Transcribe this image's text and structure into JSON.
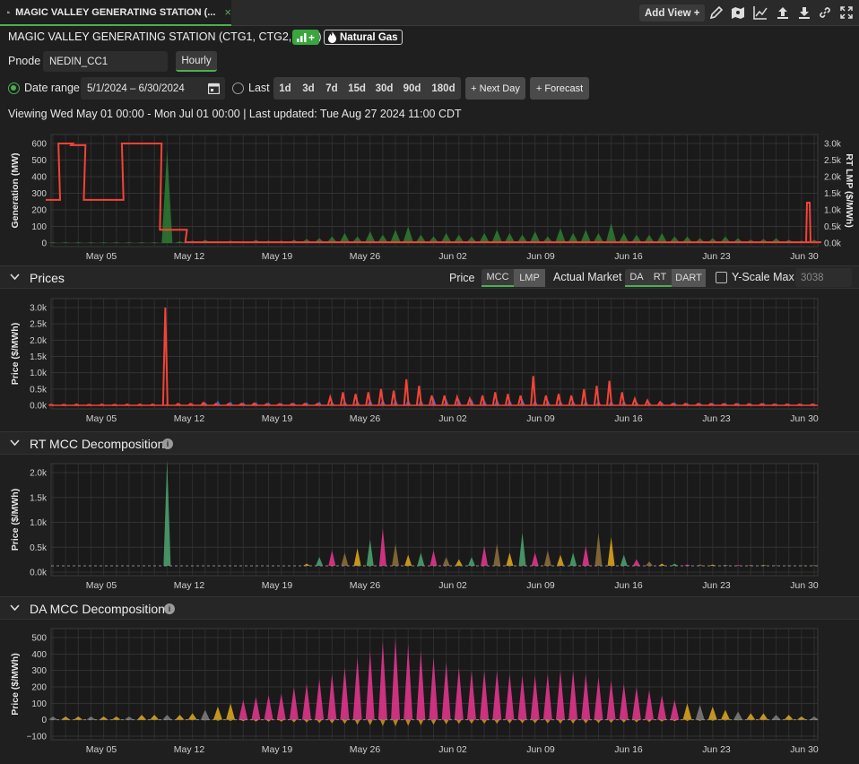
{
  "tab": {
    "title": "MAGIC VALLEY GENERATING STATION (...",
    "close": "×"
  },
  "toolbar": {
    "add_view_label": "Add View +"
  },
  "header": {
    "station_title": "MAGIC VALLEY GENERATING STATION (CTG1, CTG2, STG)",
    "gen_badge_plus": "+",
    "fuel_badge": "Natural Gas"
  },
  "pnode": {
    "label": "Pnode",
    "value": "NEDIN_CC1",
    "granularity": "Hourly"
  },
  "range": {
    "date_range_label": "Date range",
    "date_value": "5/1/2024  –  6/30/2024",
    "last_label": "Last",
    "last_options": [
      "1d",
      "3d",
      "7d",
      "15d",
      "30d",
      "90d",
      "180d"
    ],
    "next_day_label": "+ Next Day",
    "forecast_label": "+ Forecast"
  },
  "viewing_text": "Viewing Wed May 01 00:00 - Mon Jul 01 00:00 | Last updated: Tue Aug 27 2024 11:00 CDT",
  "prices_panel": {
    "title": "Prices",
    "price_label": "Price",
    "price_options": [
      "MCC",
      "LMP"
    ],
    "market_label": "Actual Market",
    "market_options": [
      "DA",
      "RT",
      "DART"
    ],
    "yscale_label": "Y-Scale Max",
    "yscale_value": "3038"
  },
  "rt_panel": {
    "title": "RT MCC Decomposition"
  },
  "da_panel": {
    "title": "DA MCC Decomposition"
  },
  "colors": {
    "accent": "#4caf50",
    "rt_lmp": "#f44336",
    "generation": "#2e7d32",
    "da": "#1e6fe0",
    "pink": "#e0348c",
    "gold": "#d8a21a"
  },
  "chart_data": [
    {
      "type": "line",
      "ylabel": "Generation (MW)",
      "y2label": "RT LMP ($/MWh)",
      "yticks": [
        "0",
        "100",
        "200",
        "300",
        "400",
        "500",
        "600"
      ],
      "y2ticks": [
        "0.0k",
        "0.5k",
        "1.0k",
        "1.5k",
        "2.0k",
        "2.5k",
        "3.0k"
      ],
      "xticks": [
        "May 05",
        "May 12",
        "May 19",
        "May 26",
        "Jun 02",
        "Jun 09",
        "Jun 16",
        "Jun 23",
        "Jun 30"
      ],
      "series": [
        {
          "values_note": "",
          "x": [
            1,
            2,
            3,
            4,
            5,
            6,
            7,
            8,
            9,
            10,
            11,
            12,
            13,
            14,
            15,
            16,
            17,
            18,
            19,
            20,
            21,
            22,
            23,
            24,
            25,
            26,
            27,
            28,
            29,
            30,
            31,
            32,
            33,
            34,
            35,
            36,
            37,
            38,
            39,
            40,
            41,
            42,
            43,
            44,
            45,
            46,
            47,
            48,
            49,
            50,
            51,
            52,
            53,
            54,
            55,
            56,
            57,
            58,
            59,
            60,
            61
          ],
          "values": [
            260,
            600,
            590,
            260,
            260,
            260,
            600,
            600,
            600,
            80,
            80,
            5,
            5,
            5,
            5,
            5,
            5,
            5,
            5,
            5,
            5,
            5,
            5,
            5,
            5,
            5,
            5,
            5,
            5,
            5,
            5,
            5,
            5,
            5,
            5,
            5,
            5,
            5,
            5,
            5,
            5,
            5,
            5,
            5,
            5,
            5,
            5,
            5,
            5,
            5,
            5,
            5,
            5,
            5,
            5,
            5,
            5,
            5,
            5,
            5,
            5
          ]
        }
      ]
    },
    {
      "type": "line",
      "ylabel": "Price ($/MWh)",
      "yticks": [
        "0.0k",
        "0.5k",
        "1.0k",
        "1.5k",
        "2.0k",
        "2.5k",
        "3.0k"
      ],
      "xticks": [
        "May 05",
        "May 12",
        "May 19",
        "May 26",
        "Jun 02",
        "Jun 09",
        "Jun 16",
        "Jun 23",
        "Jun 30"
      ],
      "series": [
        {
          "values": [
            0.02,
            0.02,
            0.03,
            0.02,
            0.03,
            0.02,
            0.03,
            0.03,
            0.03,
            3.0,
            0.05,
            0.05,
            0.08,
            0.05,
            0.05,
            0.05,
            0.06,
            0.04,
            0.04,
            0.05,
            0.05,
            0.05,
            0.25,
            0.4,
            0.35,
            0.4,
            0.5,
            0.45,
            0.8,
            0.6,
            0.3,
            0.3,
            0.25,
            0.2,
            0.3,
            0.4,
            0.35,
            0.3,
            0.9,
            0.3,
            0.35,
            0.3,
            0.5,
            0.6,
            0.75,
            0.4,
            0.2,
            0.15,
            0.1,
            0.05,
            0.05,
            0.05,
            0.05,
            0.04,
            0.04,
            0.04,
            0.04,
            0.03,
            0.03,
            0.03,
            0.03
          ]
        },
        {
          "values": [
            0.02,
            0.02,
            0.02,
            0.02,
            0.02,
            0.02,
            0.02,
            0.02,
            0.02,
            0.05,
            0.05,
            0.05,
            0.1,
            0.15,
            0.12,
            0.1,
            0.1,
            0.1,
            0.08,
            0.08,
            0.1,
            0.12,
            0.12,
            0.15,
            0.15,
            0.2,
            0.2,
            0.2,
            0.2,
            0.2,
            0.25,
            0.2,
            0.2,
            0.2,
            0.18,
            0.2,
            0.18,
            0.2,
            0.18,
            0.18,
            0.15,
            0.15,
            0.15,
            0.15,
            0.15,
            0.15,
            0.12,
            0.1,
            0.1,
            0.1,
            0.08,
            0.08,
            0.08,
            0.08,
            0.08,
            0.06,
            0.08,
            0.06,
            0.06,
            0.05,
            0.05
          ]
        }
      ]
    },
    {
      "type": "area",
      "ylabel": "Price ($/MWh)",
      "yticks": [
        "0.0k",
        "0.5k",
        "1.0k",
        "1.5k",
        "2.0k"
      ],
      "xticks": [
        "May 05",
        "May 12",
        "May 19",
        "May 26",
        "Jun 02",
        "Jun 09",
        "Jun 16",
        "Jun 23",
        "Jun 30"
      ],
      "series": [
        {
          "values": [
            0,
            0,
            0,
            0,
            0,
            0,
            0,
            0,
            0,
            2.4,
            0,
            0,
            0,
            0,
            0,
            0,
            0,
            0,
            0,
            0,
            0.05,
            0.2,
            0.35,
            0.3,
            0.4,
            0.6,
            0.85,
            0.5,
            0.25,
            0.3,
            0.35,
            0.2,
            0.15,
            0.2,
            0.45,
            0.5,
            0.3,
            0.75,
            0.3,
            0.35,
            0.25,
            0.3,
            0.45,
            0.75,
            0.65,
            0.25,
            0.15,
            0.1,
            0.05,
            0.05,
            0.03,
            0.03,
            0.03,
            0.02,
            0.02,
            0.02,
            0.02,
            0.01,
            0.01,
            0.01,
            0.01
          ]
        }
      ]
    },
    {
      "type": "area",
      "ylabel": "Price ($/MWh)",
      "yticks": [
        "−100",
        "0",
        "100",
        "200",
        "300",
        "400",
        "500"
      ],
      "xticks": [
        "May 05",
        "May 12",
        "May 19",
        "May 26",
        "Jun 02",
        "Jun 09",
        "Jun 16",
        "Jun 23",
        "Jun 30"
      ],
      "series": [
        {
          "values": [
            20,
            20,
            20,
            20,
            20,
            20,
            20,
            30,
            30,
            30,
            30,
            40,
            60,
            80,
            100,
            120,
            140,
            150,
            160,
            200,
            220,
            250,
            280,
            320,
            380,
            420,
            480,
            500,
            460,
            420,
            380,
            350,
            320,
            300,
            300,
            300,
            280,
            270,
            270,
            280,
            300,
            300,
            280,
            260,
            240,
            220,
            200,
            180,
            150,
            120,
            100,
            90,
            80,
            60,
            50,
            40,
            40,
            30,
            30,
            20,
            20
          ]
        }
      ]
    }
  ]
}
